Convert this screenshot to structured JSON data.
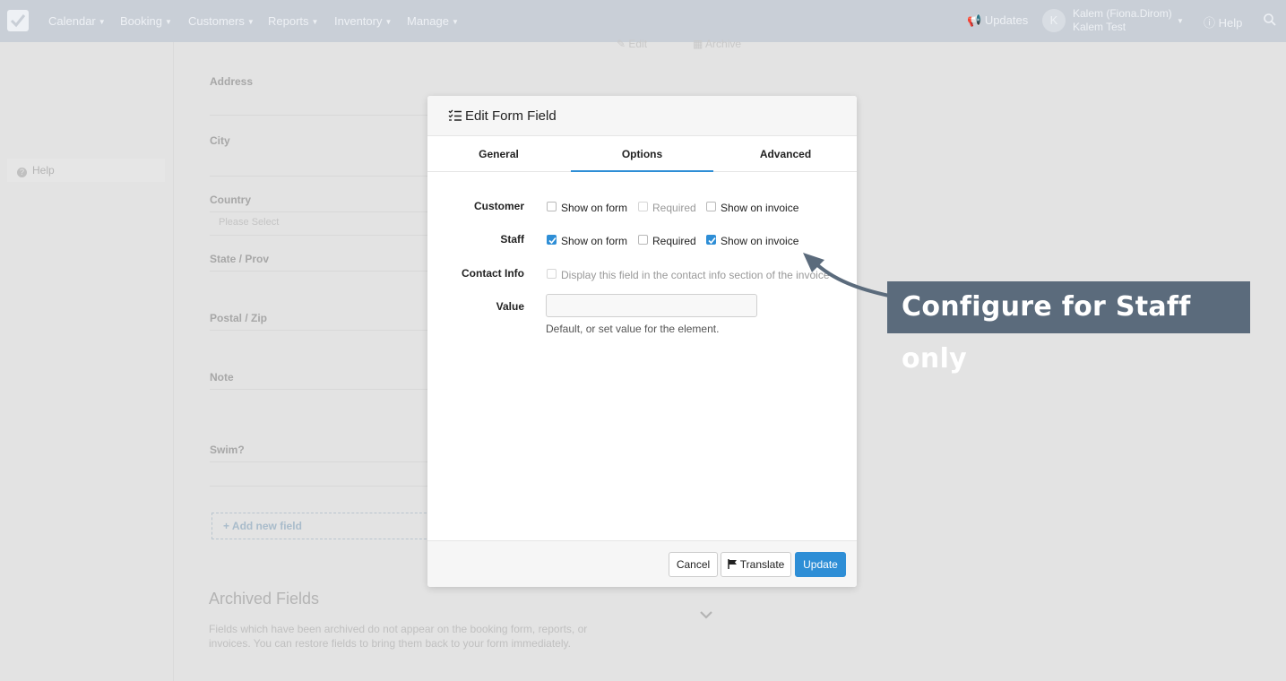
{
  "nav": {
    "items": [
      "Calendar",
      "Booking",
      "Customers",
      "Reports",
      "Inventory",
      "Manage"
    ],
    "updates": "Updates",
    "avatar_initial": "K",
    "user_line1": "Kalem (Fiona.Dirom)",
    "user_line2": "Kalem Test",
    "help": "Help"
  },
  "sidebar": {
    "help": "Help"
  },
  "background": {
    "edit": "Edit",
    "archive": "Archive",
    "fields": [
      "Address",
      "City",
      "Country",
      "State / Prov",
      "Postal / Zip",
      "Note",
      "Swim?"
    ],
    "country_placeholder": "Please Select",
    "add_field": "+ Add new field",
    "archived_title": "Archived Fields",
    "archived_desc": "Fields which have been archived do not appear on the booking form, reports, or invoices. You can restore fields to bring them back to your form immediately."
  },
  "modal": {
    "title": "Edit Form Field",
    "tabs": [
      {
        "label": "General",
        "active": false
      },
      {
        "label": "Options",
        "active": true
      },
      {
        "label": "Advanced",
        "active": false
      }
    ],
    "rows": {
      "customer": {
        "label": "Customer",
        "show_on_form": {
          "label": "Show on form",
          "checked": false
        },
        "required": {
          "label": "Required",
          "checked": false,
          "disabled": true
        },
        "show_on_invoice": {
          "label": "Show on invoice",
          "checked": false
        }
      },
      "staff": {
        "label": "Staff",
        "show_on_form": {
          "label": "Show on form",
          "checked": true
        },
        "required": {
          "label": "Required",
          "checked": false
        },
        "show_on_invoice": {
          "label": "Show on invoice",
          "checked": true
        }
      },
      "contact_info": {
        "label": "Contact Info",
        "option": {
          "label": "Display this field in the contact info section of the invoice",
          "checked": false,
          "disabled": true
        }
      },
      "value": {
        "label": "Value",
        "input_value": "",
        "help": "Default, or set value for the element."
      }
    },
    "footer": {
      "cancel": "Cancel",
      "translate": "Translate",
      "update": "Update"
    }
  },
  "callout": {
    "text": "Configure for Staff only"
  },
  "colors": {
    "accent": "#2e8ed6",
    "callout_bg": "#5b6b7c",
    "nav_bg": "#c9cfd7"
  }
}
